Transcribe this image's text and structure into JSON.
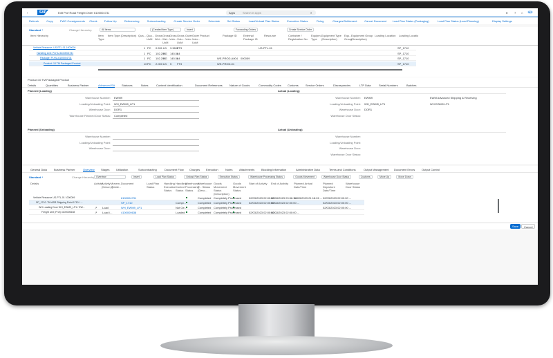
{
  "shell": {
    "title": "Edit Prof Road Freight Order 6100004731",
    "search_scope": "Apps",
    "search_placeholder": "Search in Apps",
    "avatar": "MS"
  },
  "toolbar": {
    "items": [
      "Refresh",
      "Copy",
      "FWO Consignments",
      "Check",
      "Follow Up",
      "Referencing",
      "Subcontracting",
      "Create Service Order",
      "Schedule",
      "Set Status",
      "Load/Unload Plan Status",
      "Execution Status",
      "Fixing",
      "Charges/Settlement",
      "Cancel Document",
      "Load Plan Status (Packaging)",
      "Load Plan Status (Load Planning)"
    ],
    "display_settings": "Display Settings"
  },
  "item_table": {
    "variant": "Standard *",
    "change_hierarchy_label": "Change Hierarchy:",
    "hierarchy_value": "All Items",
    "insert_type": "(Created Item Type)",
    "insert": "Insert",
    "forwarding_orders": "Forwarding Orders",
    "create_service_order": "Create Service Order",
    "columns": [
      "Item Hierarchy",
      "Item Type",
      "Item Type (Description)",
      "Qua...",
      "Qua... UoM",
      "Gross Wei...",
      "Gross Wei... UoM",
      "Gross Volu...",
      "Gross Volu... UoM",
      "Outer Volu...",
      "Outer Volu... UoM",
      "Product",
      "Package ID",
      "External Package ID",
      "Resource",
      "Container / Registration No.",
      "Equipm... Type",
      "Equipment Type (Description)",
      "Equ... Group",
      "Equipment Group (Description)",
      "Loading Location",
      "Loading Locatio"
    ],
    "rows": [
      {
        "hierarchy": "Vehicle Resource: US-PTL-01 1000009",
        "qty": "1",
        "uom": "PC",
        "gw": "0.531",
        "gwu": "LB",
        "gv": "3.3600",
        "gvu": "FT3",
        "product": "",
        "package": "",
        "resource": "US-PTL-01",
        "loc2": "SP_1710"
      },
      {
        "hierarchy": "Handling Unit: PI-HU-6100004731",
        "qty": "1",
        "uom": "PC",
        "gw": "102.205",
        "gwu": "KG",
        "gv": "145.564",
        "gvu": "L",
        "product": "",
        "package": "",
        "resource": "",
        "loc2": "SP_1710"
      },
      {
        "hierarchy": "Package: PI-HU-6100004731",
        "qty": "1",
        "uom": "PC",
        "gw": "102.205",
        "gwu": "KG",
        "gv": "145.564",
        "gvu": "L",
        "product": "WE-PROD-A004",
        "package": "000059",
        "resource": "",
        "loc2": "SP_1710"
      },
      {
        "hierarchy": "Product: 10 TM Packaged Product",
        "qty": "10",
        "uom": "PC",
        "gw": "2.000",
        "gwu": "LB",
        "gv": "5",
        "gvu": "FT3",
        "product": "WE-PROD-01",
        "package": "",
        "resource": "",
        "loc2": "SP_1710"
      }
    ]
  },
  "detail": {
    "title": "Product:10 TM Packaged Product",
    "tabs": [
      "Details",
      "Quantities",
      "Business Partner",
      "Advanced SA",
      "Statuses",
      "Notes",
      "Content Identification",
      "Document References",
      "Nature of Goods",
      "Commodity Codes",
      "Customs",
      "Service Orders",
      "Discrepancies",
      "LTP Data",
      "Serial Numbers",
      "Batches"
    ],
    "selected_tab": "Advanced SA",
    "planned_loading": {
      "title": "Planned (Loading)",
      "fields": [
        {
          "label": "Warehouse Number:",
          "value": "EWM9"
        },
        {
          "label": "Loading/Unloading Point:",
          "value": "WH_EWM9_LP1"
        },
        {
          "label": "Warehouse Door:",
          "value": "DOR1"
        },
        {
          "label": "Warehouse Planned Door Status:",
          "value": "Completed"
        }
      ]
    },
    "actual_loading": {
      "title": "Actual (Loading)",
      "fields": [
        {
          "label": "Warehouse Number:",
          "value": "EWM9",
          "desc": "EWM Advanced Shipping & Receiving"
        },
        {
          "label": "Loading/Unloading Point:",
          "value": "WH_EWM9_LP1",
          "desc": "WH EWM9 LP1"
        },
        {
          "label": "Warehouse Door:",
          "value": "DOR1",
          "desc": ""
        },
        {
          "label": "Warehouse Door Status:",
          "value": "",
          "desc": ""
        }
      ]
    },
    "planned_unloading": {
      "title": "Planned (Unloading)",
      "fields": [
        {
          "label": "Warehouse Number:"
        },
        {
          "label": "Loading/Unloading Point:"
        },
        {
          "label": "Warehouse Door:"
        }
      ]
    },
    "actual_unloading": {
      "title": "Actual (Unloading)",
      "fields": [
        {
          "label": "Warehouse Number:"
        },
        {
          "label": "Loading/Unloading Point:"
        },
        {
          "label": "Warehouse Door:"
        },
        {
          "label": "Warehouse Door Status:"
        }
      ]
    }
  },
  "bottom": {
    "tabs": [
      "General Data",
      "Business Partner",
      "Overview",
      "Stages",
      "Utilization",
      "Subcontracting",
      "Document Flow",
      "Charges",
      "Execution",
      "Notes",
      "Attachments",
      "Blocking Information",
      "Administrative Data",
      "Terms and Conditions",
      "Output Management",
      "Document Errors",
      "Output Control"
    ],
    "selected_tab": "Overview",
    "variant": "Standard *",
    "change_hierarchy_label": "Change Hierarchy:",
    "hierarchy_value": "Overview",
    "insert": "Insert",
    "tools": [
      "Load Plan Status",
      "Unload Plan Status",
      "Execution Status",
      "Warehouse Processing Status",
      "Goods Movement",
      "Warehouse Door Status",
      "Customs",
      "Move Up",
      "Move Down"
    ],
    "columns": [
      "Details",
      "Activity",
      "Activity (Descr...)",
      "Movem... (Relati...",
      "Document",
      "Load Plan Status",
      "Handling Execution Status",
      "Handling Control Status",
      "Warehouse Processing Status",
      "Warehouse P... Status (Desc...",
      "Goods Movement Status (Description)",
      "Goods Movement Status",
      "Start of Activity",
      "End of Activity",
      "Planned Arrival Date/Time",
      "Planned Departure Date/Time",
      "Warehouse Door Status"
    ],
    "rows": [
      {
        "details": "Vehicle Resource US-PTL-01 1000009",
        "activity": "",
        "activity_desc": "",
        "document": "6100004731",
        "hstat": "",
        "hctrl": "",
        "wpd": "Completed",
        "gmd": "Completely Processed",
        "start": "02/03/2023 02:00:00 ...",
        "end": "02/03/2023 03:56:14 ...",
        "arr": "02/03/2023 21:18:26 ...",
        "dep": "02/03/2023 02:00:00 ..."
      },
      {
        "details": "SP_1710: TM ASR Shipping Point 1710 / ...",
        "activity": "",
        "activity_desc": "",
        "document": "SP_1710",
        "hstat": "",
        "hctrl": "Compl...",
        "wpd": "Completed",
        "gmd": "Completely Processed",
        "start": "02/03/2023 02:00:00 ...",
        "end": "02/03/2023 02:00:00 ...",
        "arr": "",
        "dep": "02/03/2023 02:00:00 ..."
      },
      {
        "details": "WH Loading Door WH_EWM9_LP1 / EW...",
        "activity": "",
        "activity_desc": "Load",
        "document": "WH_EWM9_LP1",
        "hstat": "",
        "hctrl": "Not Ge...",
        "wpd": "Completed",
        "gmd": "Completely Processed",
        "start": "",
        "end": "",
        "arr": "",
        "dep": "02/03/2023 02:00:00 ..."
      },
      {
        "details": "Freight Unit (Prof) 4100000638",
        "activity": "",
        "activity_desc": "Load /...",
        "document": "4100000638",
        "hstat": "",
        "hctrl": "Loaded",
        "wpd": "Completed",
        "gmd": "Completely Processed",
        "start": "02/03/2023 02:00:00 ...",
        "end": "02/03/2023 02:00:00 ...",
        "arr": "",
        "dep": ""
      }
    ]
  },
  "footer": {
    "save": "Save",
    "cancel": "Cancel"
  },
  "colors": {
    "brand": "#0a6ed1",
    "status_green": "#107e3e",
    "selected_row": "#e5f0fa"
  }
}
